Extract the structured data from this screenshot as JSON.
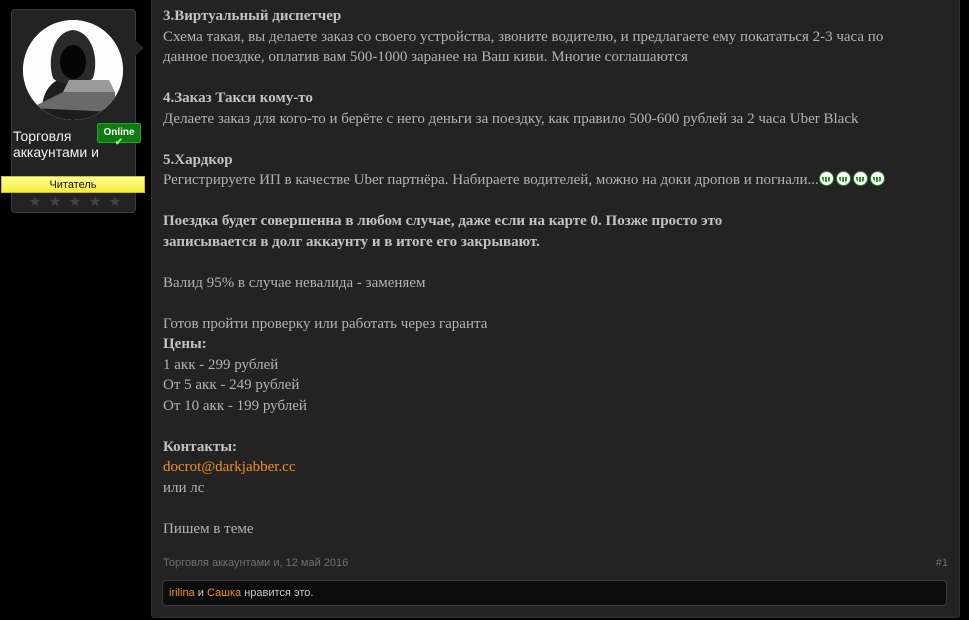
{
  "user": {
    "name": "Торговля аккаунтами и",
    "status": "Online",
    "role": "Читатель",
    "stars": 5
  },
  "post": {
    "lines": [
      {
        "type": "heading",
        "text": "3.Виртуальный диспетчер"
      },
      {
        "type": "text",
        "text": "Схема такая, вы делаете заказ со своего устройства, звоните водителю, и предлагаете ему покататься 2-3 часа по"
      },
      {
        "type": "text",
        "text": "данное поездке, оплатив вам 500-1000 заранее на Ваш киви. Многие соглашаются"
      },
      {
        "type": "gap"
      },
      {
        "type": "heading",
        "text": "4.Заказ Такси кому-то"
      },
      {
        "type": "text",
        "text": "Делаете заказ для кого-то и берёте с него деньги за поездку, как правило 500-600 рублей за 2 часа Uber Black"
      },
      {
        "type": "gap"
      },
      {
        "type": "heading",
        "text": "5.Хардкор"
      },
      {
        "type": "smiley-line",
        "text": "Регистрируете ИП в качестве Uber партнёра. Набираете водителей, можно на доки дропов и погнали..."
      },
      {
        "type": "gap"
      },
      {
        "type": "heading",
        "text": "Поездка будет совершенна в любом случае, даже если на карте 0. Позже просто это"
      },
      {
        "type": "heading",
        "text": "записывается в долг аккаунту и в итоге его закрывают."
      },
      {
        "type": "gap"
      },
      {
        "type": "text",
        "text": "Валид 95% в случае невалида - заменяем"
      },
      {
        "type": "gap"
      },
      {
        "type": "text",
        "text": "Готов пройти проверку или работать через гаранта"
      },
      {
        "type": "heading",
        "text": "Цены:"
      },
      {
        "type": "text",
        "text": "1 акк - 299 рублей"
      },
      {
        "type": "text",
        "text": "От 5 акк - 249 рублей"
      },
      {
        "type": "text",
        "text": "От 10 акк - 199 рублей"
      },
      {
        "type": "gap"
      },
      {
        "type": "heading",
        "text": "Контакты:"
      },
      {
        "type": "link",
        "text": "docrot@darkjabber.cc"
      },
      {
        "type": "text",
        "text": "или лс"
      },
      {
        "type": "gap"
      },
      {
        "type": "text",
        "text": "Пишем в теме"
      }
    ],
    "smiley_count": 4,
    "author_date": "Торговля аккаунтами и, 12 май 2016",
    "post_number": "#1",
    "likes": {
      "user1": "irilina",
      "conj": "и",
      "user2": "Сашка",
      "suffix": "нравится это."
    }
  }
}
